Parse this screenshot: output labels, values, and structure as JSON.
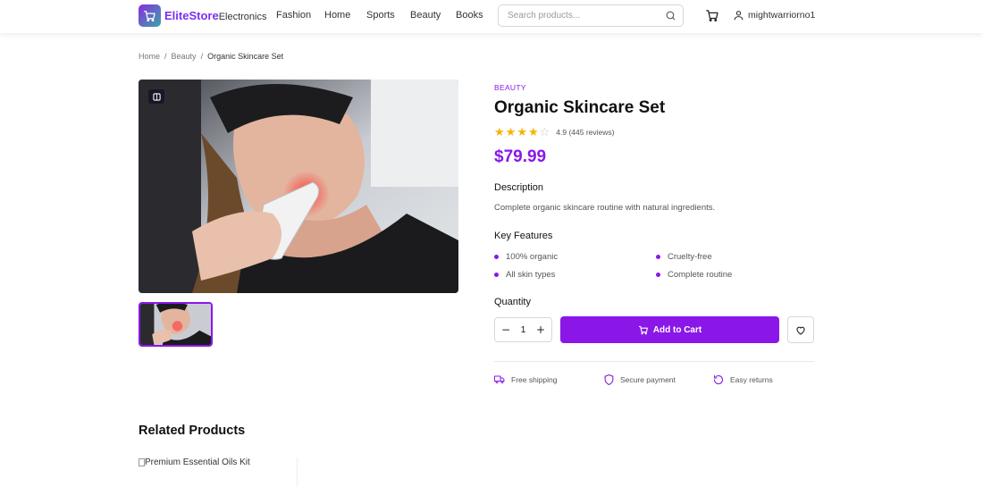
{
  "header": {
    "logo_primary": "EliteStore",
    "logo_secondary": "Electronics",
    "nav": [
      "Fashion",
      "Home",
      "Sports",
      "Beauty",
      "Books"
    ],
    "search_placeholder": "Search products...",
    "username": "mightwarriorno1"
  },
  "breadcrumb": [
    "Home",
    "Beauty",
    "Organic Skincare Set"
  ],
  "product": {
    "category": "BEAUTY",
    "name": "Organic Skincare Set",
    "rating": 4.9,
    "stars_filled": 4,
    "stars_total": 5,
    "rating_text": "4.9 (445 reviews)",
    "price": "$79.99",
    "description_heading": "Description",
    "description": "Complete organic skincare routine with natural ingredients.",
    "features_heading": "Key Features",
    "features": [
      "100% organic",
      "Cruelty-free",
      "All skin types",
      "Complete routine"
    ],
    "quantity_heading": "Quantity",
    "quantity": "1",
    "add_to_cart": "Add to Cart",
    "perks": [
      "Free shipping",
      "Secure payment",
      "Easy returns"
    ]
  },
  "related": {
    "heading": "Related Products",
    "items": [
      {
        "alt": "Premium Essential Oils Kit"
      }
    ]
  },
  "colors": {
    "accent": "#8a17e8",
    "star": "#f5b400"
  }
}
